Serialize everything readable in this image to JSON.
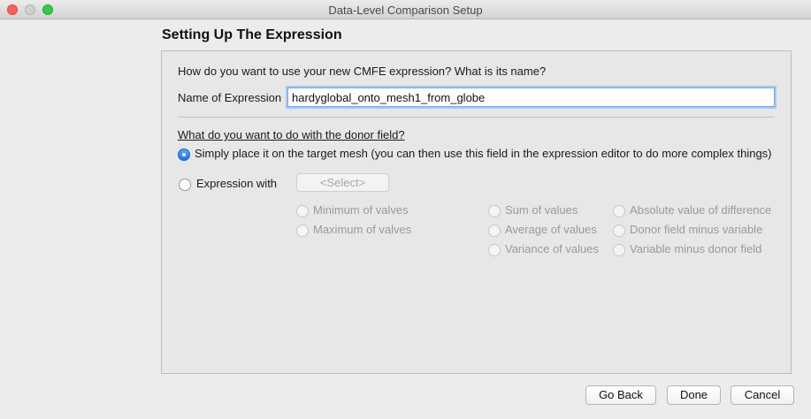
{
  "window": {
    "title": "Data-Level Comparison Setup"
  },
  "page": {
    "heading": "Setting Up The Expression"
  },
  "name_section": {
    "question": "How do you want to use your new CMFE expression?  What is its name?",
    "label": "Name of Expression",
    "value": "hardyglobal_onto_mesh1_from_globe"
  },
  "donor_section": {
    "question": "What do you want to do with the donor field?",
    "option_place": "Simply place it on the target mesh (you can then use this field in the expression editor to do more complex things)",
    "option_expression": "Expression with",
    "select_label": "<Select>",
    "ops": {
      "min": "Minimum of valves",
      "max": "Maximum of valves",
      "sum": "Sum of values",
      "avg": "Average of values",
      "var": "Variance of values",
      "absdiff": "Absolute value of difference",
      "donor_minus": "Donor field minus variable",
      "var_minus": "Variable minus donor field"
    }
  },
  "buttons": {
    "back": "Go Back",
    "done": "Done",
    "cancel": "Cancel"
  }
}
